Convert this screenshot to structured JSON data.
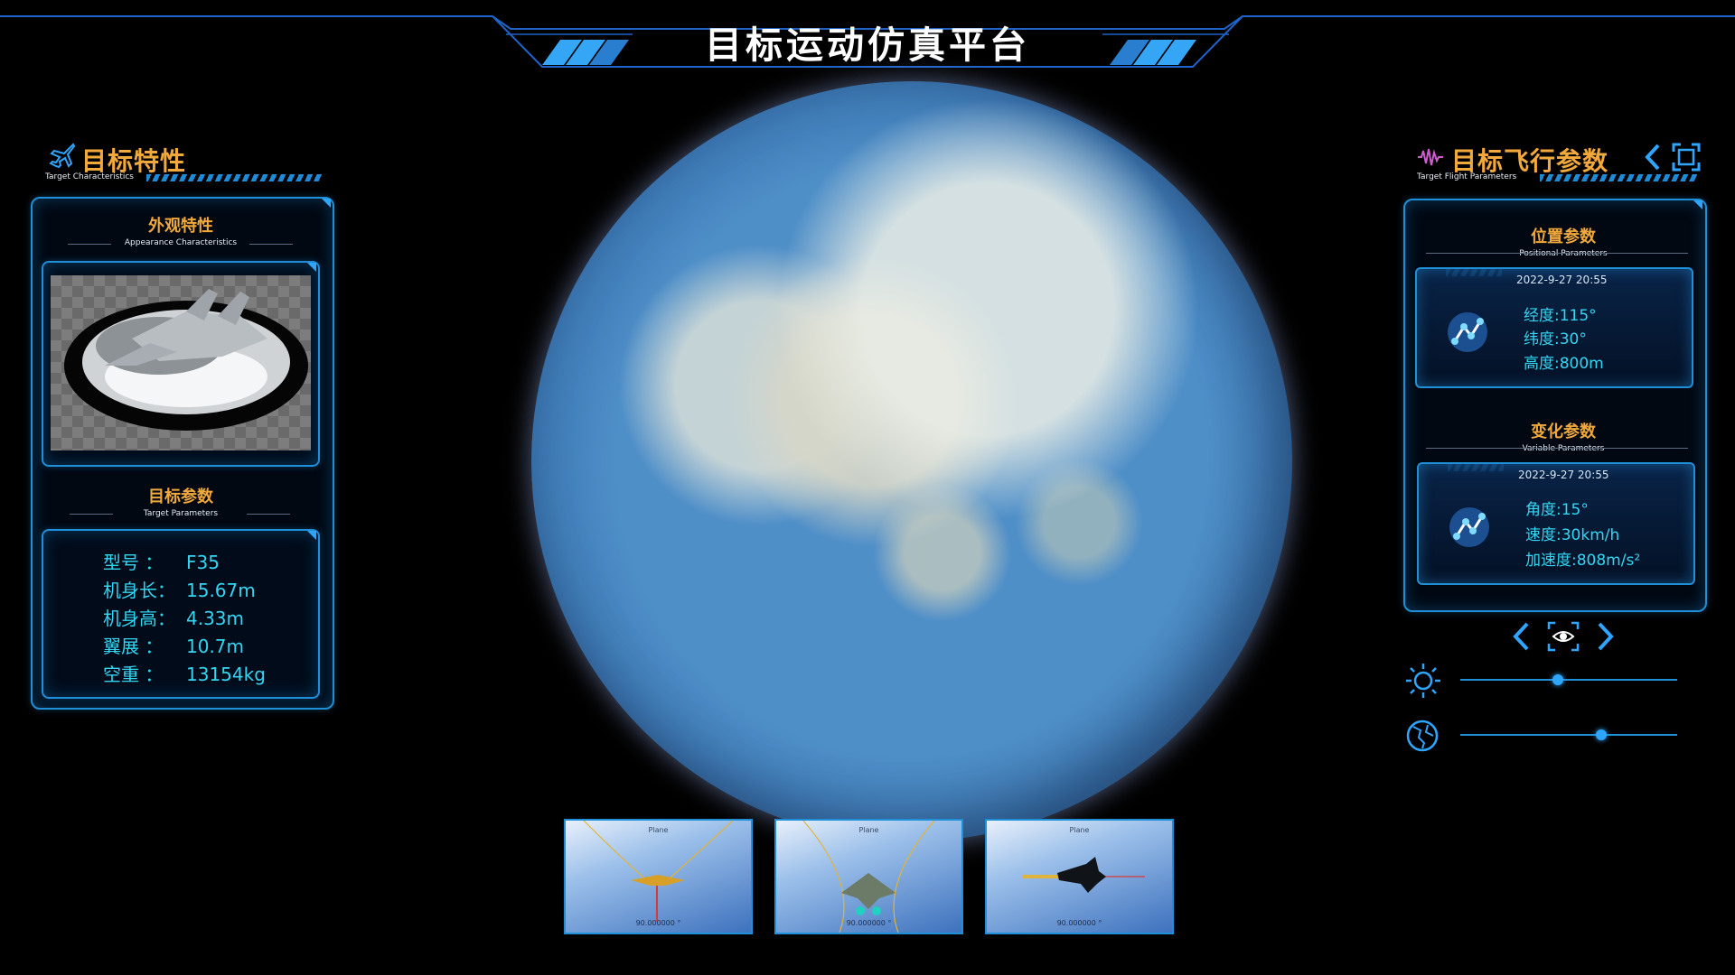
{
  "header": {
    "title": "目标运动仿真平台"
  },
  "left_panel": {
    "title": "目标特性",
    "subtitle": "Target Characteristics",
    "appearance": {
      "title": "外观特性",
      "subtitle": "Appearance Characteristics"
    },
    "params": {
      "title": "目标参数",
      "subtitle": "Target Parameters",
      "rows": [
        {
          "key": "型号  ：",
          "value": "F35"
        },
        {
          "key": "机身长：",
          "value": "15.67m"
        },
        {
          "key": "机身高：",
          "value": "4.33m"
        },
        {
          "key": "翼展  ：",
          "value": "10.7m"
        },
        {
          "key": "空重  ：",
          "value": "13154kg"
        }
      ]
    }
  },
  "right_panel": {
    "title": "目标飞行参数",
    "subtitle": "Target Flight Parameters",
    "positional": {
      "title": "位置参数",
      "subtitle": "Positional Parameters",
      "date": "2022-9-27 20:55",
      "lines": [
        "经度:115°",
        "纬度:30°",
        "高度:800m"
      ]
    },
    "variable": {
      "title": "变化参数",
      "subtitle": "Variable Parameters",
      "date": "2022-9-27 20:55",
      "lines": [
        "角度:15°",
        "速度:30km/h",
        "加速度:808m/s²"
      ]
    }
  },
  "controls": {
    "brightness_level": 0.45,
    "globe_level": 0.65
  },
  "thumbnails": [
    {
      "label": "Plane",
      "value": "90.000000 °"
    },
    {
      "label": "Plane",
      "value": "90.000000 °"
    },
    {
      "label": "Plane",
      "value": "90.000000 °"
    }
  ],
  "colors": {
    "accent": "#1f8fd8",
    "heading": "#f2a93b",
    "value": "#33d6f2"
  },
  "icons": [
    "plane-icon",
    "waveform-icon",
    "back-chevron-icon",
    "fullscreen-icon",
    "prev-icon",
    "eye-icon",
    "next-icon",
    "sun-icon",
    "globe-icon",
    "chart-node-icon"
  ]
}
